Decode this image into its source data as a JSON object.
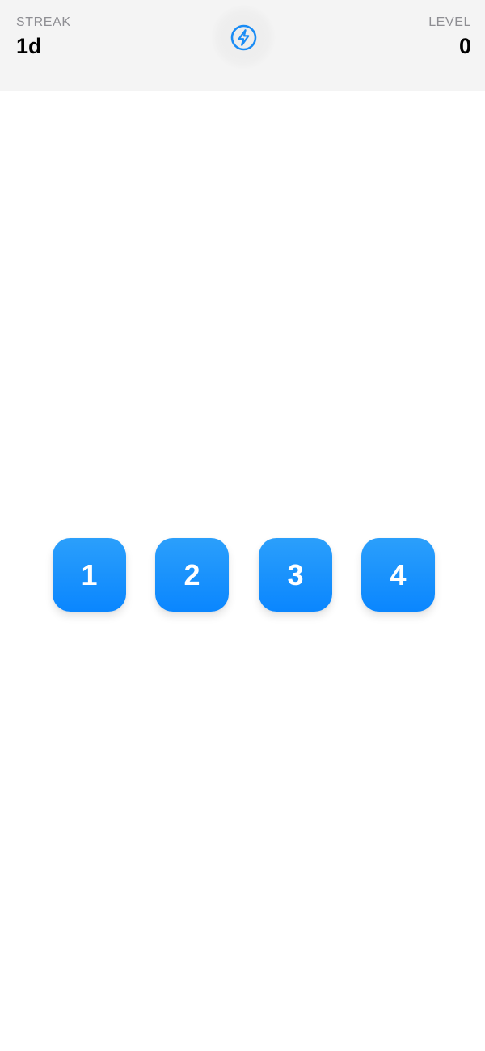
{
  "header": {
    "streak_label": "STREAK",
    "streak_value": "1d",
    "level_label": "LEVEL",
    "level_value": "0",
    "center_icon": "lightning-bolt-icon"
  },
  "colors": {
    "accent": "#0a86fe",
    "button_top": "#2b9ffb",
    "header_bg": "#f4f4f4",
    "label_gray": "#8e8e93"
  },
  "number_buttons": [
    "1",
    "2",
    "3",
    "4"
  ]
}
